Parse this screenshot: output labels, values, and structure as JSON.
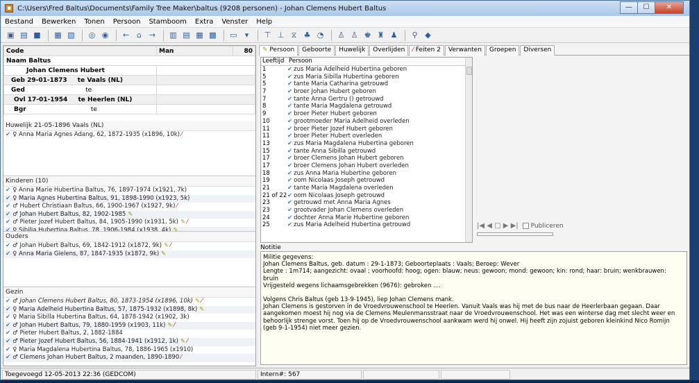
{
  "window": {
    "title": "C:\\Users\\Fred Baltus\\Documents\\Family Tree Maker\\baltus (9208 personen) - Johan Clemens Hubert Baltus",
    "minimize": "—",
    "maximize": "☐",
    "close": "✕"
  },
  "menu": [
    "Bestand",
    "Bewerken",
    "Tonen",
    "Persoon",
    "Stamboom",
    "Extra",
    "Venster",
    "Help"
  ],
  "person": {
    "code_label": "Code",
    "gender": "Man",
    "code_value": "80",
    "naam_label": "Naam Baltus",
    "given_names": "Johan Clemens Hubert",
    "geb_label": "Geb 29-01-1873",
    "geb_place": "te Vaals (NL)",
    "ged_label": "Ged",
    "ged_place": "te",
    "ovl_label": "Ovl 17-01-1954",
    "ovl_place": "te Heerlen (NL)",
    "bgr_label": "Bgr",
    "bgr_place": "te"
  },
  "marriage": {
    "header": "Huwelijk 21-05-1896 Vaals (NL)",
    "spouse": "♀ Anna Maria Agnes Adang, 62, 1872-1935 (x1896, 10k)"
  },
  "children": {
    "header": "Kinderen (10)",
    "items": [
      "♀ Anna Marie Hubertina Baltus, 76, 1897-1974 (x1921, 7k)",
      "♀ Maria Agnes Hubertina Baltus, 91, 1898-1990 (x1923, 5k)",
      "♂ Hubert Christiaan Baltus, 66, 1900-1967 (x1927, 9k)",
      "♂ Johan Hubert Baltus, 82, 1902-1985",
      "♂ Pieter Jozef Hubert Baltus, 84, 1905-1990 (x1931, 5k)",
      "♀ Sibilia Hubertina Baltus, 78, 1906-1984 (x1938, 4k)"
    ]
  },
  "parents": {
    "header": "Ouders",
    "items": [
      "♂ Johan Hubert Baltus, 69, 1842-1912 (x1872, 9k)",
      "♀ Anna Maria Gielens, 87, 1847-1935 (x1872, 9k)"
    ]
  },
  "siblings": {
    "header": "Gezin",
    "items": [
      "♂ Johan Clemens Hubert Baltus, 80, 1873-1954 (x1896, 10k)",
      "♀ Maria Adelheid Hubertina Baltus, 57, 1875-1932 (x1898, 8k)",
      "♀ Maria Sibilla Hubertina Baltus, 64, 1878-1942 (x1902, 3k)",
      "♂ Johan Hubert Baltus, 79, 1880-1959 (x1903, 11k)",
      "♂ Pieter Hubert Baltus, 2, 1882-1884",
      "♂ Pieter Jozef Hubert Baltus, 56, 1884-1941 (x1912, 1k)",
      "♀ Maria Magdalena Hubertina Baltus, 78, 1886-1965 (x1910)",
      "♂ Clemens Johan Hubert Baltus, 2 maanden, 1890-1890"
    ]
  },
  "tabs": [
    "Persoon",
    "Geboorte",
    "Huwelijk",
    "Overlijden",
    "Feiten 2",
    "Verwanten",
    "Groepen",
    "Diversen"
  ],
  "list": {
    "col_age": "Leeftijd",
    "col_person": "Persoon",
    "rows": [
      {
        "age": "1",
        "text": "zus Maria Adelheid Hubertina geboren"
      },
      {
        "age": "5",
        "text": "zus Maria Sibilla Hubertina geboren"
      },
      {
        "age": "5",
        "text": "tante Maria Catharina getrouwd"
      },
      {
        "age": "7",
        "text": "broer Johan Hubert geboren"
      },
      {
        "age": "7",
        "text": "tante Anna Gertru () getrouwd"
      },
      {
        "age": "8",
        "text": "tante Maria Magdalena getrouwd"
      },
      {
        "age": "9",
        "text": "broer Pieter Hubert geboren"
      },
      {
        "age": "10",
        "text": "grootmoeder Maria Adelheid overleden"
      },
      {
        "age": "11",
        "text": "broer Pieter Jozef Hubert geboren"
      },
      {
        "age": "11",
        "text": "broer Pieter Hubert overleden"
      },
      {
        "age": "13",
        "text": "zus Maria Magdalena Hubertina geboren"
      },
      {
        "age": "15",
        "text": "tante Anna Sibilla getrouwd"
      },
      {
        "age": "17",
        "text": "broer Clemens Johan Hubert geboren"
      },
      {
        "age": "17",
        "text": "broer Clemens Johan Hubert overleden"
      },
      {
        "age": "18",
        "text": "zus Anna Maria Hubertine geboren"
      },
      {
        "age": "19",
        "text": "oom Nicolaas Joseph getrouwd"
      },
      {
        "age": "21",
        "text": "tante Maria Magdalena overleden"
      },
      {
        "age": "21 of 22",
        "text": "oom Nicolaas Joseph getrouwd"
      },
      {
        "age": "23",
        "text": "getrouwd met Anna Maria Agnes"
      },
      {
        "age": "23",
        "text": "grootvader Johan Clemens overleden"
      },
      {
        "age": "24",
        "text": "dochter Anna Marie Hubertine geboren"
      },
      {
        "age": "25",
        "text": "zus Maria Adelheid Hubertina getrouwd"
      }
    ]
  },
  "media": {
    "controls": "|◀ ◀ □ ▶ ▶|",
    "publish_label": "Publiceren"
  },
  "notes": {
    "label": "Notitie",
    "lines": [
      "Militie gegevens:",
      "Johan Clemens Baltus, geb. datum : 29-1-1873; Geboorteplaats : Vaals; Beroep: Wever",
      "Lengte : 1m714; aangezicht: ovaal ; voorhoofd: hoog; ogen: blauw; neus: gewoon; mond: gewoon; kin: rond; haar: bruin; wenkbrauwen:",
      "bruin",
      "Vrijgesteld wegens lichaamsgebrekken (9676): gebroken ....",
      "",
      "Volgens Chris Baltus (geb 13-9-1945), liep Johan Clemens mank.",
      "Johan Clemens is gestorven in de Vroedvrouwenschool te Heerlen. Vanuit Vaals was hij met de bus naar de Heerlerbaan gegaan. Daar",
      "aangekomen moest hij nog via de Clemens Meulenmansstraat naar de Vroedvrouwenschool. Het was een winterse dag met slecht weer en",
      "behoorlijk strenge vorst. Toen hij op de Vroedvrouwenschool aankwam werd hij onwel. Hij heeft zijn zojuist geboren kleinkind Nico Romijn",
      "(geb 9-1-1954) niet meer gezien."
    ]
  },
  "status": {
    "added": "Toegevoegd 12-05-2013 22:36  (GEDCOM)",
    "intern": "Intern#: 567"
  }
}
